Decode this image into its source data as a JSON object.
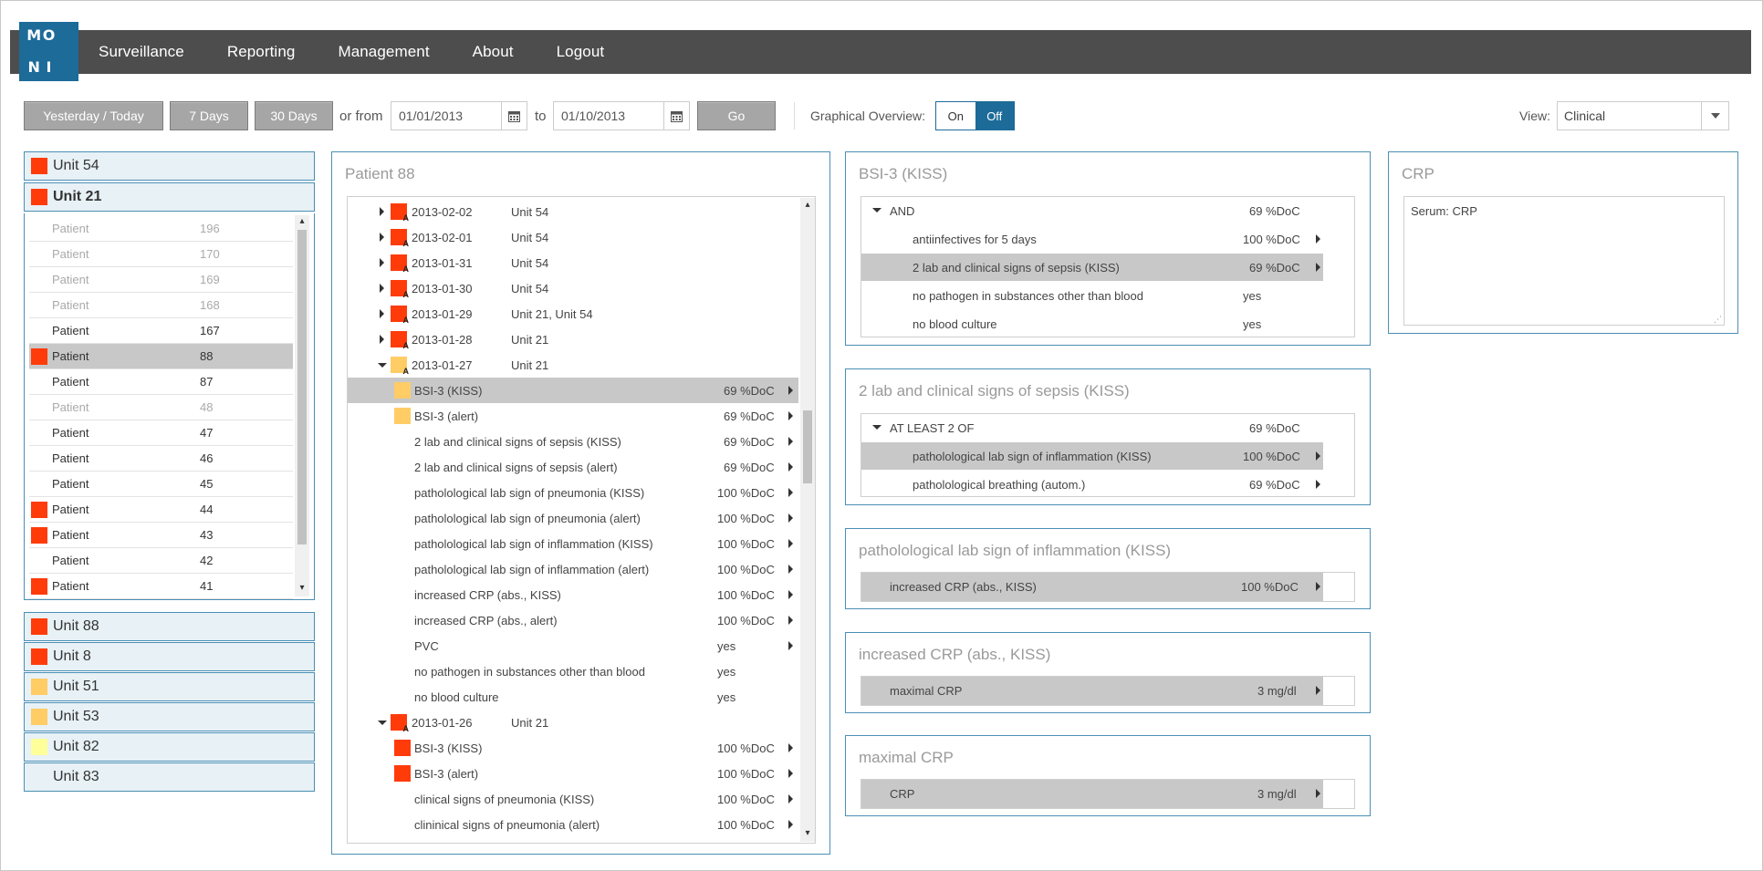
{
  "logo": [
    "M",
    "O",
    "",
    "",
    "",
    "",
    "N",
    "I",
    ""
  ],
  "nav": [
    "Surveillance",
    "Reporting",
    "Management",
    "About",
    "Logout"
  ],
  "toolbar": {
    "yesterday_today": "Yesterday / Today",
    "days7": "7 Days",
    "days30": "30 Days",
    "or_from": "or from",
    "from_date": "01/01/2013",
    "to": "to",
    "to_date": "01/10/2013",
    "go": "Go",
    "graphical_overview": "Graphical Overview:",
    "on": "On",
    "off": "Off",
    "view_label": "View:",
    "view_value": "Clinical"
  },
  "colors": {
    "red": "#ff3b0a",
    "orange": "#ffcc66",
    "yellow": "#ffff99",
    "brand": "#1c6b99"
  },
  "units": [
    {
      "name": "Unit 54",
      "color": "red"
    },
    {
      "name": "Unit 21",
      "color": "red"
    },
    {
      "name": "Unit 88",
      "color": "red"
    },
    {
      "name": "Unit 8",
      "color": "red"
    },
    {
      "name": "Unit 51",
      "color": "orange"
    },
    {
      "name": "Unit 53",
      "color": "orange"
    },
    {
      "name": "Unit 82",
      "color": "yellow"
    },
    {
      "name": "Unit 83",
      "color": ""
    }
  ],
  "patients": [
    {
      "label": "Patient",
      "id": "196",
      "dim": true,
      "color": ""
    },
    {
      "label": "Patient",
      "id": "170",
      "dim": true,
      "color": ""
    },
    {
      "label": "Patient",
      "id": "169",
      "dim": true,
      "color": ""
    },
    {
      "label": "Patient",
      "id": "168",
      "dim": true,
      "color": ""
    },
    {
      "label": "Patient",
      "id": "167",
      "dim": false,
      "color": ""
    },
    {
      "label": "Patient",
      "id": "88",
      "dim": false,
      "color": "red",
      "selected": true
    },
    {
      "label": "Patient",
      "id": "87",
      "dim": false,
      "color": ""
    },
    {
      "label": "Patient",
      "id": "48",
      "dim": true,
      "color": ""
    },
    {
      "label": "Patient",
      "id": "47",
      "dim": false,
      "color": ""
    },
    {
      "label": "Patient",
      "id": "46",
      "dim": false,
      "color": ""
    },
    {
      "label": "Patient",
      "id": "45",
      "dim": false,
      "color": ""
    },
    {
      "label": "Patient",
      "id": "44",
      "dim": false,
      "color": "red"
    },
    {
      "label": "Patient",
      "id": "43",
      "dim": false,
      "color": "red"
    },
    {
      "label": "Patient",
      "id": "42",
      "dim": false,
      "color": ""
    },
    {
      "label": "Patient",
      "id": "41",
      "dim": false,
      "color": "red"
    }
  ],
  "patient_panel": {
    "title": "Patient 88",
    "rows": [
      {
        "kind": "date",
        "expanded": false,
        "color": "red",
        "date": "2013-02-02",
        "unit": "Unit 54"
      },
      {
        "kind": "date",
        "expanded": false,
        "color": "red",
        "date": "2013-02-01",
        "unit": "Unit 54"
      },
      {
        "kind": "date",
        "expanded": false,
        "color": "red",
        "date": "2013-01-31",
        "unit": "Unit 54"
      },
      {
        "kind": "date",
        "expanded": false,
        "color": "red",
        "date": "2013-01-30",
        "unit": "Unit 54"
      },
      {
        "kind": "date",
        "expanded": false,
        "color": "red",
        "date": "2013-01-29",
        "unit": "Unit 21, Unit 54"
      },
      {
        "kind": "date",
        "expanded": false,
        "color": "red",
        "date": "2013-01-28",
        "unit": "Unit 21"
      },
      {
        "kind": "date",
        "expanded": true,
        "color": "orange",
        "date": "2013-01-27",
        "unit": "Unit 21"
      },
      {
        "kind": "item",
        "color": "orange",
        "label": "BSI-3 (KISS)",
        "value": "69 %DoC",
        "arrow": true,
        "selected": true
      },
      {
        "kind": "item",
        "color": "orange",
        "label": "BSI-3 (alert)",
        "value": "69 %DoC",
        "arrow": true
      },
      {
        "kind": "item",
        "color": "",
        "label": "2 lab and clinical signs of sepsis (KISS)",
        "value": "69 %DoC",
        "arrow": true
      },
      {
        "kind": "item",
        "color": "",
        "label": "2 lab and clinical signs of sepsis (alert)",
        "value": "69 %DoC",
        "arrow": true
      },
      {
        "kind": "item",
        "color": "",
        "label": "patholological lab sign of pneumonia (KISS)",
        "value": "100 %DoC",
        "arrow": true
      },
      {
        "kind": "item",
        "color": "",
        "label": "patholological lab sign of pneumonia (alert)",
        "value": "100 %DoC",
        "arrow": true
      },
      {
        "kind": "item",
        "color": "",
        "label": "patholological lab sign of inflammation (KISS)",
        "value": "100 %DoC",
        "arrow": true
      },
      {
        "kind": "item",
        "color": "",
        "label": "patholological lab sign of inflammation (alert)",
        "value": "100 %DoC",
        "arrow": true
      },
      {
        "kind": "item",
        "color": "",
        "label": "increased CRP (abs., KISS)",
        "value": "100 %DoC",
        "arrow": true
      },
      {
        "kind": "item",
        "color": "",
        "label": "increased CRP (abs., alert)",
        "value": "100 %DoC",
        "arrow": true
      },
      {
        "kind": "item",
        "color": "",
        "label": "PVC",
        "value": "yes",
        "arrow": true
      },
      {
        "kind": "item",
        "color": "",
        "label": "no pathogen in substances other than blood",
        "value": "yes",
        "arrow": false
      },
      {
        "kind": "item",
        "color": "",
        "label": "no blood culture",
        "value": "yes",
        "arrow": false
      },
      {
        "kind": "date",
        "expanded": true,
        "color": "red",
        "date": "2013-01-26",
        "unit": "Unit 21"
      },
      {
        "kind": "item",
        "color": "red",
        "label": "BSI-3 (KISS)",
        "value": "100 %DoC",
        "arrow": true
      },
      {
        "kind": "item",
        "color": "red",
        "label": "BSI-3 (alert)",
        "value": "100 %DoC",
        "arrow": true
      },
      {
        "kind": "item",
        "color": "",
        "label": "clinical signs of pneumonia (KISS)",
        "value": "100 %DoC",
        "arrow": true
      },
      {
        "kind": "item",
        "color": "",
        "label": "clininical signs of pneumonia (alert)",
        "value": "100 %DoC",
        "arrow": true
      }
    ]
  },
  "bsi_panel": {
    "title": "BSI-3 (KISS)",
    "rows": [
      {
        "label": "AND",
        "value": "69 %DoC",
        "root": true,
        "arrow": false
      },
      {
        "label": "antiinfectives for 5 days",
        "value": "100 %DoC",
        "arrow": true
      },
      {
        "label": "2 lab and clinical signs of sepsis (KISS)",
        "value": "69 %DoC",
        "arrow": true,
        "selected": true
      },
      {
        "label": "no pathogen in substances other than blood",
        "value": "yes",
        "arrow": false
      },
      {
        "label": "no blood culture",
        "value": "yes",
        "arrow": false
      }
    ]
  },
  "sepsis_panel": {
    "title": "2 lab and clinical signs of sepsis (KISS)",
    "rows": [
      {
        "label": "AT LEAST 2 OF",
        "value": "69 %DoC",
        "root": true,
        "arrow": false
      },
      {
        "label": "patholological lab sign of inflammation (KISS)",
        "value": "100 %DoC",
        "arrow": true,
        "selected": true
      },
      {
        "label": "patholological breathing (autom.)",
        "value": "69 %DoC",
        "arrow": true
      }
    ]
  },
  "inflammation_panel": {
    "title": "patholological lab sign of inflammation (KISS)",
    "row": {
      "label": "increased CRP (abs., KISS)",
      "value": "100 %DoC"
    }
  },
  "crp_incr_panel": {
    "title": "increased CRP (abs., KISS)",
    "row": {
      "label": "maximal CRP",
      "value": "3 mg/dl"
    }
  },
  "maxcrp_panel": {
    "title": "maximal CRP",
    "row": {
      "label": "CRP",
      "value": "3 mg/dl"
    }
  },
  "crp_panel": {
    "title": "CRP",
    "text": "Serum: CRP"
  }
}
